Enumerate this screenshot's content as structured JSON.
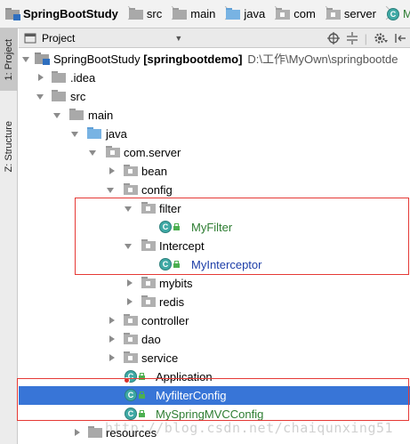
{
  "breadcrumb": {
    "items": [
      {
        "label": "SpringBootStudy",
        "icon": "module-folder-icon",
        "bold": true
      },
      {
        "label": "src",
        "icon": "folder-icon"
      },
      {
        "label": "main",
        "icon": "folder-icon"
      },
      {
        "label": "java",
        "icon": "source-folder-icon"
      },
      {
        "label": "com",
        "icon": "package-icon"
      },
      {
        "label": "server",
        "icon": "package-icon"
      },
      {
        "label": "M",
        "icon": "class-icon"
      }
    ]
  },
  "toolstrip": {
    "tabs": [
      {
        "label": "1: Project",
        "active": true
      },
      {
        "label": "Z: Structure",
        "active": false
      }
    ]
  },
  "panel": {
    "title": "Project",
    "dropdown_glyph": "▼",
    "icons": [
      "locate-icon",
      "collapse-all-icon",
      "gear-icon",
      "hide-icon"
    ]
  },
  "tree": {
    "root": {
      "name": "SpringBootStudy",
      "module": "[springbootdemo]",
      "path": "D:\\工作\\MyOwn\\springbootde"
    },
    "idea": ".idea",
    "src": "src",
    "main": "main",
    "java": "java",
    "com_server": "com.server",
    "bean": "bean",
    "config": "config",
    "filter": "filter",
    "myfilter": "MyFilter",
    "intercept": "Intercept",
    "myinterceptor": "MyInterceptor",
    "mybits": "mybits",
    "redis": "redis",
    "controller": "controller",
    "dao": "dao",
    "service": "service",
    "application": "Application",
    "myfilterconfig": "MyfilterConfig",
    "myspringmvcconfig": "MySpringMVCConfig",
    "resources": "resources"
  },
  "watermark": "http://blog.csdn.net/chaiqunxing51",
  "colors": {
    "selection": "#3875d7",
    "highlight_box": "#e53935",
    "green_class": "#2e7d32",
    "blue_class": "#1d3ea8"
  }
}
